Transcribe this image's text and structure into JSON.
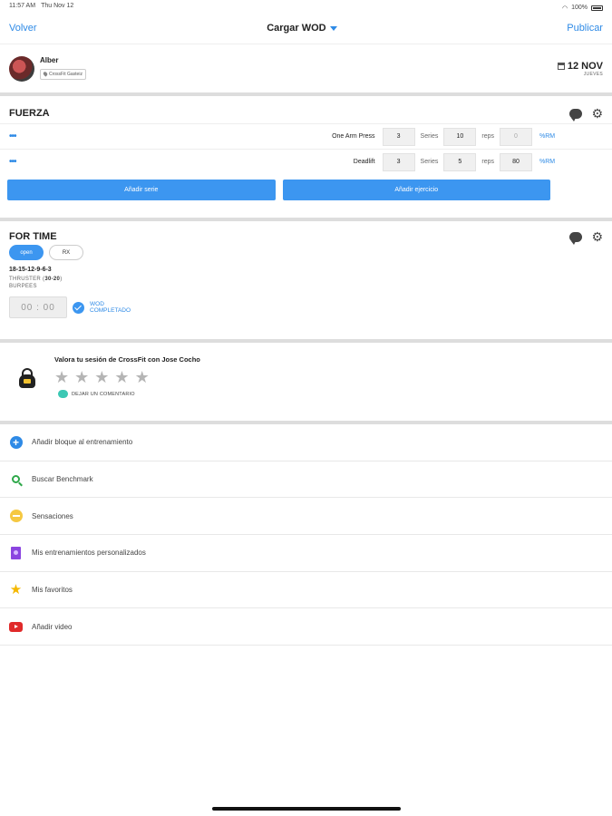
{
  "status_bar": {
    "time": "11:57 AM",
    "date": "Thu Nov 12",
    "battery": "100%"
  },
  "nav": {
    "back": "Volver",
    "title": "Cargar WOD",
    "publish": "Publicar"
  },
  "user": {
    "name": "Alber",
    "box": "CrossFit Gasteiz",
    "date": "12 NOV",
    "weekday": "JUEVES"
  },
  "fuerza": {
    "title": "FUERZA",
    "exercises": [
      {
        "more": "•••",
        "name": "One Arm Press",
        "series": "3",
        "series_label": "Series",
        "reps": "10",
        "reps_label": "reps",
        "pct": "0",
        "rm_label": "%RM"
      },
      {
        "more": "•••",
        "name": "Deadlift",
        "series": "3",
        "series_label": "Series",
        "reps": "5",
        "reps_label": "reps",
        "pct": "80",
        "rm_label": "%RM"
      }
    ],
    "add_series": "Añadir serie",
    "add_exercise": "Añadir ejercicio"
  },
  "fortime": {
    "title": "FOR TIME",
    "pills": [
      "open",
      "RX"
    ],
    "reps": "18-15-12-9-6-3",
    "movement1_name": "THRUSTER (",
    "movement1_weight": "30-20",
    "movement1_end": ")",
    "movement2": "BURPEES",
    "timer": "00 : 00",
    "completed_line1": "WOD",
    "completed_line2": "COMPLETADO"
  },
  "rating": {
    "title": "Valora tu sesión de CrossFit con Jose Cocho",
    "stars": 5,
    "star_char": "★",
    "comment": "DEJAR UN COMENTARIO"
  },
  "menu": [
    {
      "label": "Añadir bloque al entrenamiento",
      "icon": "plus-icon"
    },
    {
      "label": "Buscar Benchmark",
      "icon": "search-icon"
    },
    {
      "label": "Sensaciones",
      "icon": "face-icon"
    },
    {
      "label": "Mis entrenamientos personalizados",
      "icon": "book-icon"
    },
    {
      "label": "Mis favoritos",
      "icon": "star-icon"
    },
    {
      "label": "Añadir video",
      "icon": "youtube-icon"
    }
  ],
  "colors": {
    "accent": "#2e8ae6",
    "button": "#3c96f0",
    "separator": "#dddddd"
  }
}
